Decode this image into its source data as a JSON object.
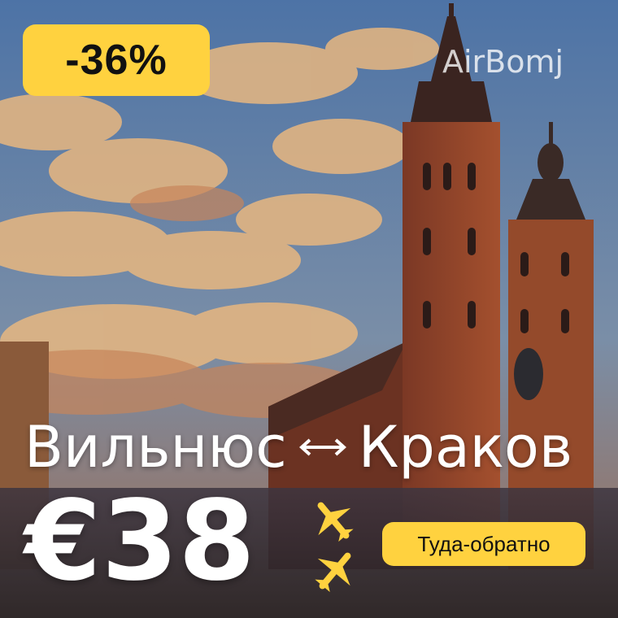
{
  "badge": {
    "discount": "-36%"
  },
  "brand": {
    "watermark": "AirBomj"
  },
  "route": {
    "origin": "Вильнюс",
    "destination": "Краков",
    "arrow_icon": "double-arrow-icon"
  },
  "price": {
    "amount": "€38"
  },
  "trip": {
    "type_label": "Туда-обратно",
    "icon": "plane-icon"
  },
  "colors": {
    "accent": "#ffd23f",
    "text": "#ffffff",
    "sky": "#4f78a8",
    "brick": "#8a3f27"
  }
}
